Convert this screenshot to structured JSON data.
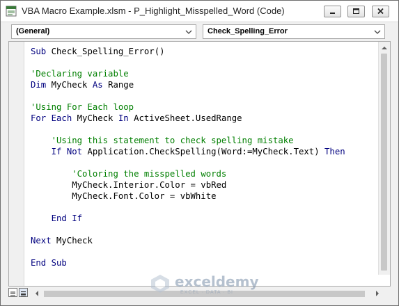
{
  "window": {
    "title": "VBA Macro Example.xlsm - P_Highlight_Misspelled_Word (Code)"
  },
  "combos": {
    "object": "(General)",
    "procedure": "Check_Spelling_Error"
  },
  "code_lines": [
    [
      {
        "t": "kw",
        "v": "Sub "
      },
      {
        "t": "tx",
        "v": "Check_Spelling_Error()"
      }
    ],
    [],
    [
      {
        "t": "cm",
        "v": "'Declaring variable"
      }
    ],
    [
      {
        "t": "kw",
        "v": "Dim "
      },
      {
        "t": "tx",
        "v": "MyCheck "
      },
      {
        "t": "kw",
        "v": "As "
      },
      {
        "t": "tx",
        "v": "Range"
      }
    ],
    [],
    [
      {
        "t": "cm",
        "v": "'Using For Each loop"
      }
    ],
    [
      {
        "t": "kw",
        "v": "For Each "
      },
      {
        "t": "tx",
        "v": "MyCheck "
      },
      {
        "t": "kw",
        "v": "In "
      },
      {
        "t": "tx",
        "v": "ActiveSheet.UsedRange"
      }
    ],
    [],
    [
      {
        "t": "tx",
        "v": "    "
      },
      {
        "t": "cm",
        "v": "'Using this statement to check spelling mistake"
      }
    ],
    [
      {
        "t": "tx",
        "v": "    "
      },
      {
        "t": "kw",
        "v": "If Not "
      },
      {
        "t": "tx",
        "v": "Application.CheckSpelling(Word:=MyCheck.Text) "
      },
      {
        "t": "kw",
        "v": "Then"
      }
    ],
    [],
    [
      {
        "t": "tx",
        "v": "        "
      },
      {
        "t": "cm",
        "v": "'Coloring the misspelled words"
      }
    ],
    [
      {
        "t": "tx",
        "v": "        MyCheck.Interior.Color = vbRed"
      }
    ],
    [
      {
        "t": "tx",
        "v": "        MyCheck.Font.Color = vbWhite"
      }
    ],
    [],
    [
      {
        "t": "tx",
        "v": "    "
      },
      {
        "t": "kw",
        "v": "End If"
      }
    ],
    [],
    [
      {
        "t": "kw",
        "v": "Next "
      },
      {
        "t": "tx",
        "v": "MyCheck"
      }
    ],
    [],
    [
      {
        "t": "kw",
        "v": "End Sub"
      }
    ]
  ],
  "watermark": {
    "name": "exceldemy",
    "tagline": "EXCEL · DATA · BI"
  },
  "colors": {
    "keyword": "#00007f",
    "comment": "#007f00",
    "text": "#000000"
  },
  "icons": {
    "app": "excel-vba-module-icon",
    "minimize": "minimize-icon",
    "maximize": "maximize-icon",
    "close": "close-icon",
    "combo_arrow": "chevron-down-icon"
  }
}
